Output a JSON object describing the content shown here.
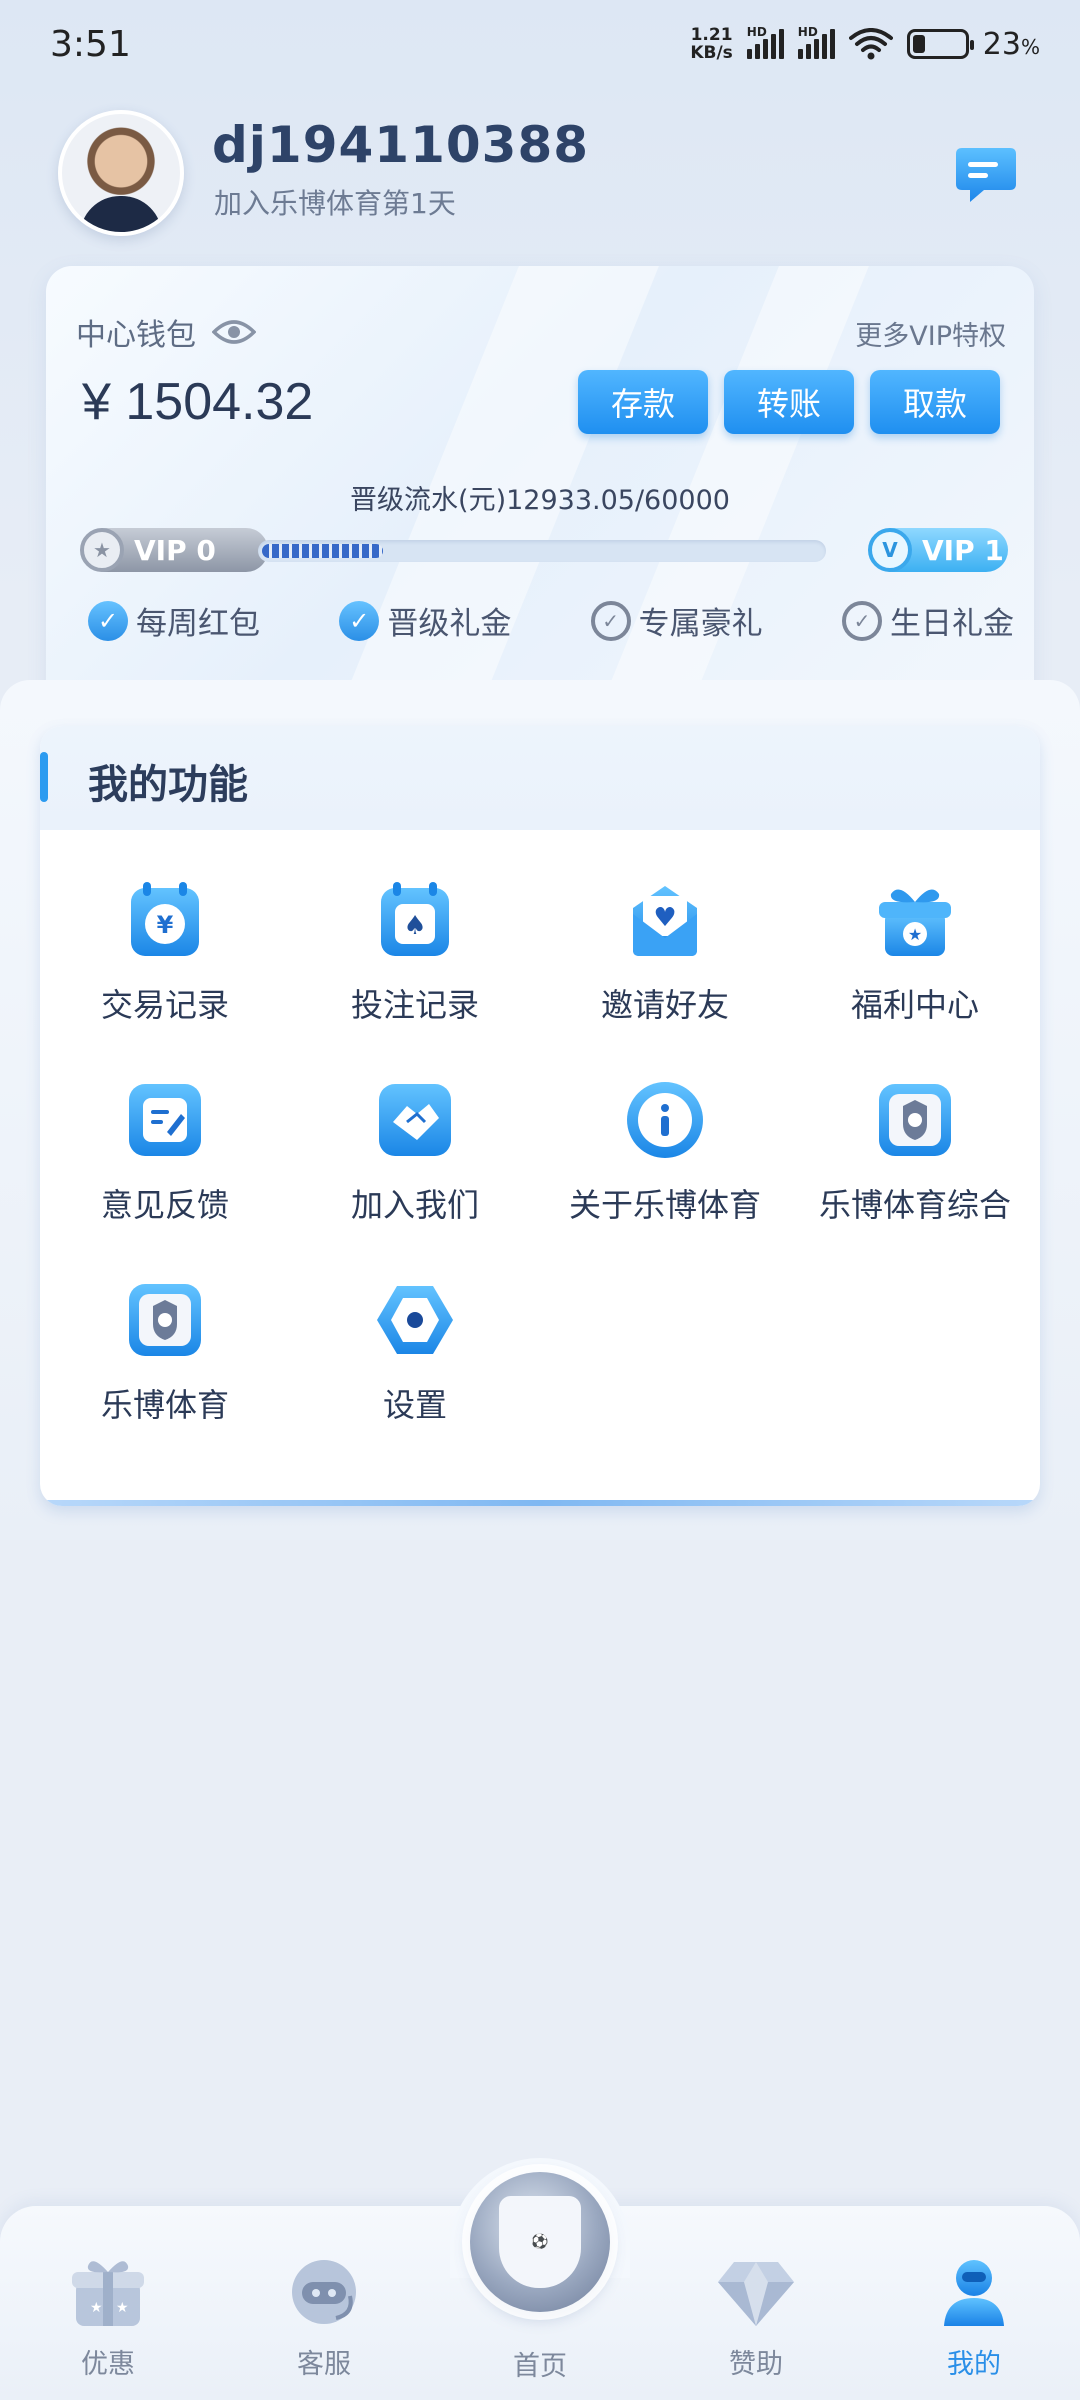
{
  "status_bar": {
    "time": "3:51",
    "net_speed_value": "1.21",
    "net_speed_unit": "KB/s",
    "signal_label_1": "HD",
    "signal_label_2": "HD",
    "battery_percent": "23",
    "battery_unit": "%"
  },
  "profile": {
    "username": "dj194110388",
    "join_text": "加入乐博体育第1天"
  },
  "wallet": {
    "label": "中心钱包",
    "more_vip": "更多VIP特权",
    "balance": "¥ 1504.32",
    "actions": {
      "deposit": "存款",
      "transfer": "转账",
      "withdraw": "取款"
    },
    "flow_text": "晋级流水(元)12933.05/60000",
    "progress_fraction": 0.216,
    "vip_from": "VIP 0",
    "vip_to": "VIP 1",
    "perks": [
      {
        "label": "每周红包",
        "checked": true
      },
      {
        "label": "晋级礼金",
        "checked": true
      },
      {
        "label": "专属豪礼",
        "checked": false
      },
      {
        "label": "生日礼金",
        "checked": false
      }
    ]
  },
  "functions": {
    "title": "我的功能",
    "items": [
      {
        "label": "交易记录",
        "icon": "yuan-calendar-icon"
      },
      {
        "label": "投注记录",
        "icon": "spade-calendar-icon"
      },
      {
        "label": "邀请好友",
        "icon": "heart-envelope-icon"
      },
      {
        "label": "福利中心",
        "icon": "gift-box-icon"
      },
      {
        "label": "意见反馈",
        "icon": "feedback-edit-icon"
      },
      {
        "label": "加入我们",
        "icon": "handshake-icon"
      },
      {
        "label": "关于乐博体育",
        "icon": "info-icon"
      },
      {
        "label": "乐博体育综合",
        "icon": "lebo-crest-icon"
      },
      {
        "label": "乐博体育",
        "icon": "lebo-crest-icon"
      },
      {
        "label": "设置",
        "icon": "settings-hexagon-icon"
      }
    ]
  },
  "bottom_nav": {
    "promo": "优惠",
    "service": "客服",
    "home": "首页",
    "sponsor": "赞助",
    "mine": "我的",
    "active": "mine"
  },
  "colors": {
    "accent": "#2a8fe8",
    "button_top": "#51b6ff",
    "button_bottom": "#1f8ff0",
    "text_primary": "#2b3a57"
  }
}
